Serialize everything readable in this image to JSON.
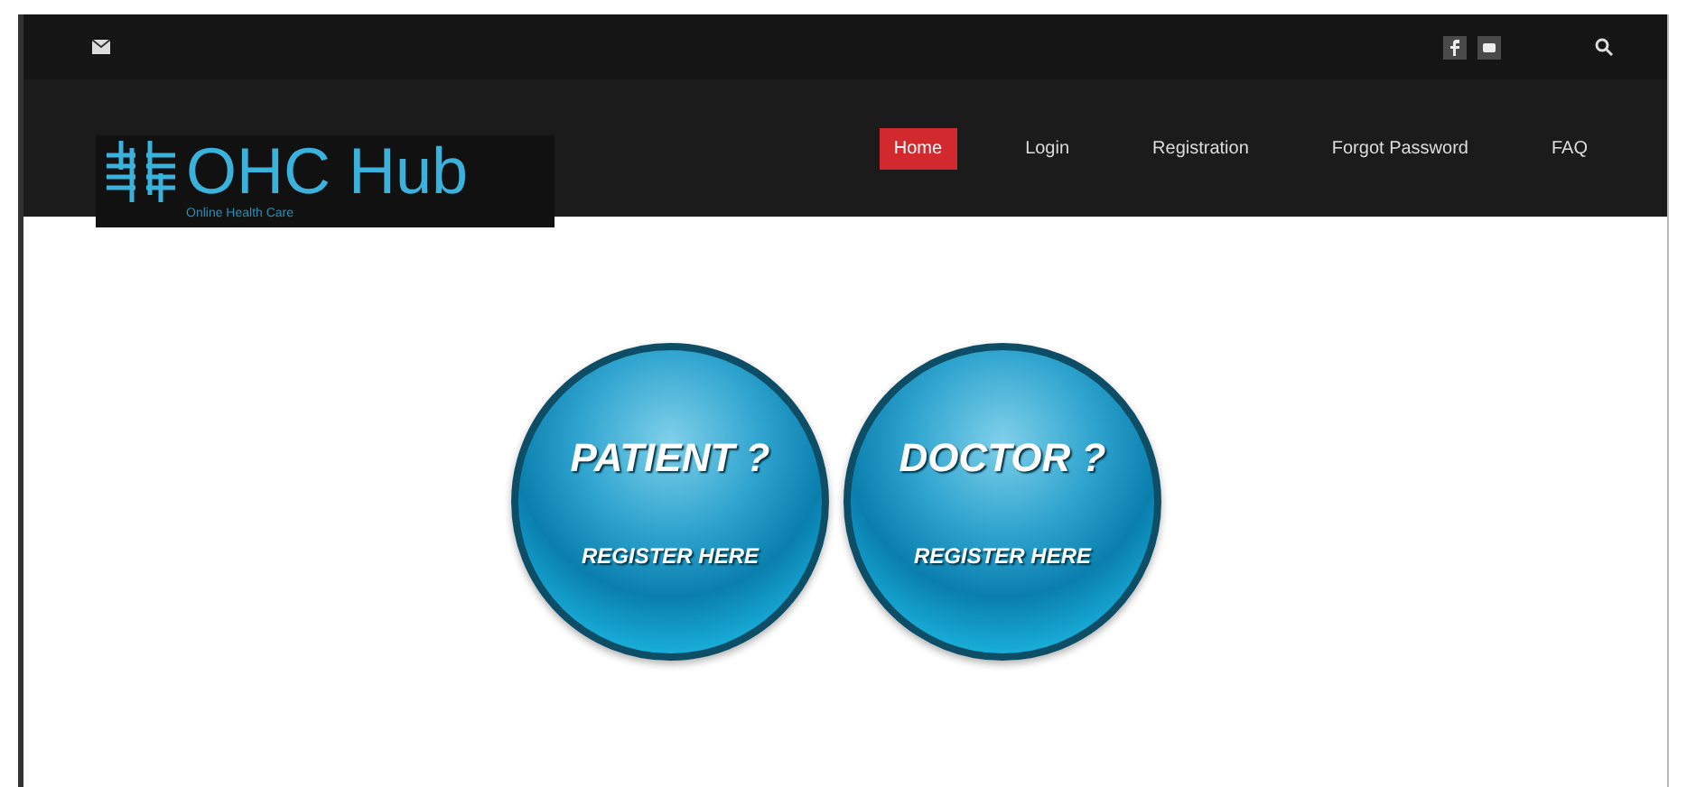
{
  "header": {
    "logo": {
      "title": "OHC Hub",
      "tagline": "Online Health Care"
    },
    "nav": [
      {
        "label": "Home",
        "selected": true
      },
      {
        "label": "Login",
        "selected": false
      },
      {
        "label": "Registration",
        "selected": false
      },
      {
        "label": "Forgot Password",
        "selected": false
      },
      {
        "label": "FAQ",
        "selected": false
      }
    ]
  },
  "register_cards": [
    {
      "title": "PATIENT ?",
      "action": "REGISTER HERE"
    },
    {
      "title": "DOCTOR ?",
      "action": "REGISTER HERE"
    }
  ]
}
